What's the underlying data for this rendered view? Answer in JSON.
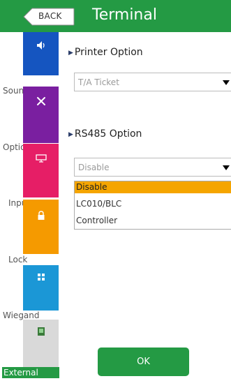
{
  "header": {
    "back_label": "BACK",
    "title": "Terminal",
    "color": "#249a44"
  },
  "sidebar": {
    "items": [
      {
        "label": "Sound",
        "color": "#1555c0",
        "icon": "speaker-icon"
      },
      {
        "label": "Options",
        "color": "#7a1fa0",
        "icon": "tools-icon"
      },
      {
        "label": "Input",
        "color": "#e61e66",
        "icon": "display-icon"
      },
      {
        "label": "Lock",
        "color": "#f59a00",
        "icon": "lock-icon"
      },
      {
        "label": "Wiegand",
        "color": "#1b97d6",
        "icon": "wiegand-icon"
      },
      {
        "label": "External",
        "color": "#d9d9d9",
        "icon": "device-icon"
      }
    ]
  },
  "main": {
    "printer_title": "Printer Option",
    "printer_value": "T/A Ticket",
    "rs485_title": "RS485 Option",
    "rs485_value": "Disable",
    "rs485_options": [
      "Disable",
      "LC010/BLC",
      "Controller"
    ],
    "rs485_selected_index": 0,
    "ok_label": "OK"
  }
}
